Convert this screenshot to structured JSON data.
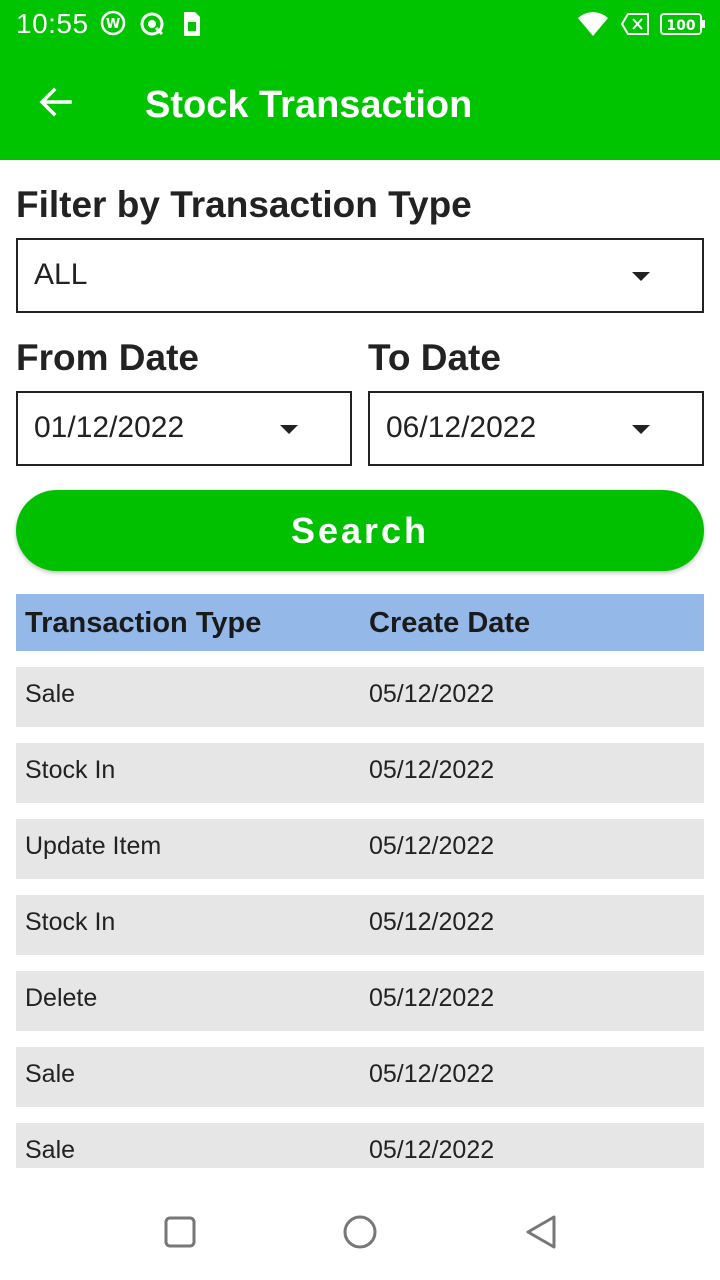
{
  "status_bar": {
    "time": "10:55",
    "battery": "100",
    "icons": [
      "vpn-icon",
      "sync-icon",
      "sim-card-icon",
      "wifi-icon",
      "no-sim-icon",
      "battery-icon"
    ]
  },
  "app_bar": {
    "title": "Stock Transaction",
    "back_icon": "arrow-left-icon"
  },
  "filter": {
    "label": "Filter by Transaction Type",
    "selected": "ALL"
  },
  "from_date": {
    "label": "From Date",
    "value": "01/12/2022"
  },
  "to_date": {
    "label": "To Date",
    "value": "06/12/2022"
  },
  "search_button": {
    "label": "Search"
  },
  "table": {
    "columns": [
      "Transaction Type",
      "Create Date"
    ],
    "rows": [
      {
        "type": "Sale",
        "date": "05/12/2022"
      },
      {
        "type": "Stock In",
        "date": "05/12/2022"
      },
      {
        "type": "Update Item",
        "date": "05/12/2022"
      },
      {
        "type": "Stock In",
        "date": "05/12/2022"
      },
      {
        "type": "Delete",
        "date": "05/12/2022"
      },
      {
        "type": "Sale",
        "date": "05/12/2022"
      },
      {
        "type": "Sale",
        "date": "05/12/2022"
      }
    ]
  },
  "colors": {
    "primary": "#00c400",
    "table_header": "#94b8e8",
    "row_background": "#e6e6e6"
  }
}
